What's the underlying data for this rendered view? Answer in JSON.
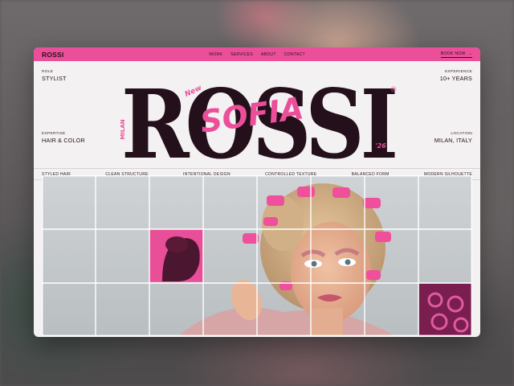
{
  "nav": {
    "brand": "ROSSI",
    "links": [
      "WORK",
      "SERVICES",
      "ABOUT",
      "CONTACT"
    ],
    "cta": "BOOK NOW",
    "cta_arrow": "→"
  },
  "hero": {
    "surname": "ROSSI",
    "first_name": "SOFIA",
    "badge_new": "New",
    "badge_city": "MILAN",
    "badge_year": "'26",
    "mark": "®",
    "role": {
      "label": "ROLE",
      "value": "STYLIST"
    },
    "expertise": {
      "label": "EXPERTISE",
      "value": "HAIR & COLOR"
    },
    "experience": {
      "label": "EXPERIENCE",
      "value": "10+ YEARS"
    },
    "location": {
      "label": "LOCATION",
      "value": "MILAN, ITALY"
    }
  },
  "tags": [
    "STYLED HAIR",
    "CLEAN STRUCTURE",
    "INTENTIONAL DESIGN",
    "CONTROLLED TEXTURE",
    "BALANCED FORM",
    "MODERN SILHOUETTE"
  ],
  "colors": {
    "accent": "#ec4f9a",
    "ink": "#24101a",
    "panel": "#f3f1f2"
  }
}
